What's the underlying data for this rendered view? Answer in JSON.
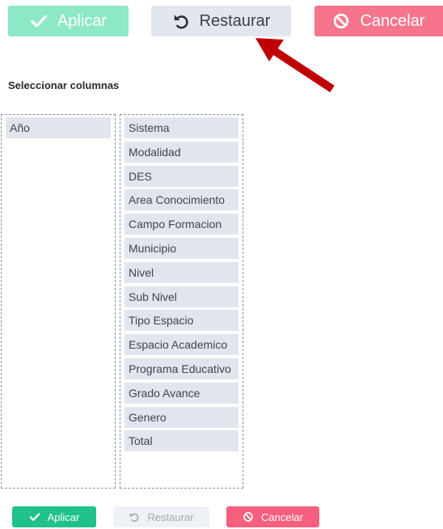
{
  "toolbar": {
    "apply_label": "Aplicar",
    "restore_label": "Restaurar",
    "cancel_label": "Cancelar"
  },
  "heading": "Seleccionar columnas",
  "selected_columns": [
    "Año"
  ],
  "available_columns": [
    "Sistema",
    "Modalidad",
    "DES",
    "Area Conocimiento",
    "Campo Formacion",
    "Municipio",
    "Nivel",
    "Sub Nivel",
    "Tipo Espacio",
    "Espacio Academico",
    "Programa Educativo",
    "Grado Avance",
    "Genero",
    "Total"
  ],
  "bottom_toolbar": {
    "apply_label": "Aplicar",
    "restore_label": "Restaurar",
    "cancel_label": "Cancelar"
  },
  "icons": {
    "apply": "check-icon",
    "restore": "undo-icon",
    "cancel": "ban-icon"
  },
  "colors": {
    "apply_top": "#8de8c6",
    "restore_top": "#e2e7ef",
    "cancel_top": "#f6758d",
    "apply_bottom": "#20c18a",
    "restore_bottom": "#eef1f5",
    "cancel_bottom": "#f5607e",
    "list_item_bg": "#e1e6ee",
    "annotation_arrow": "#c00000"
  }
}
